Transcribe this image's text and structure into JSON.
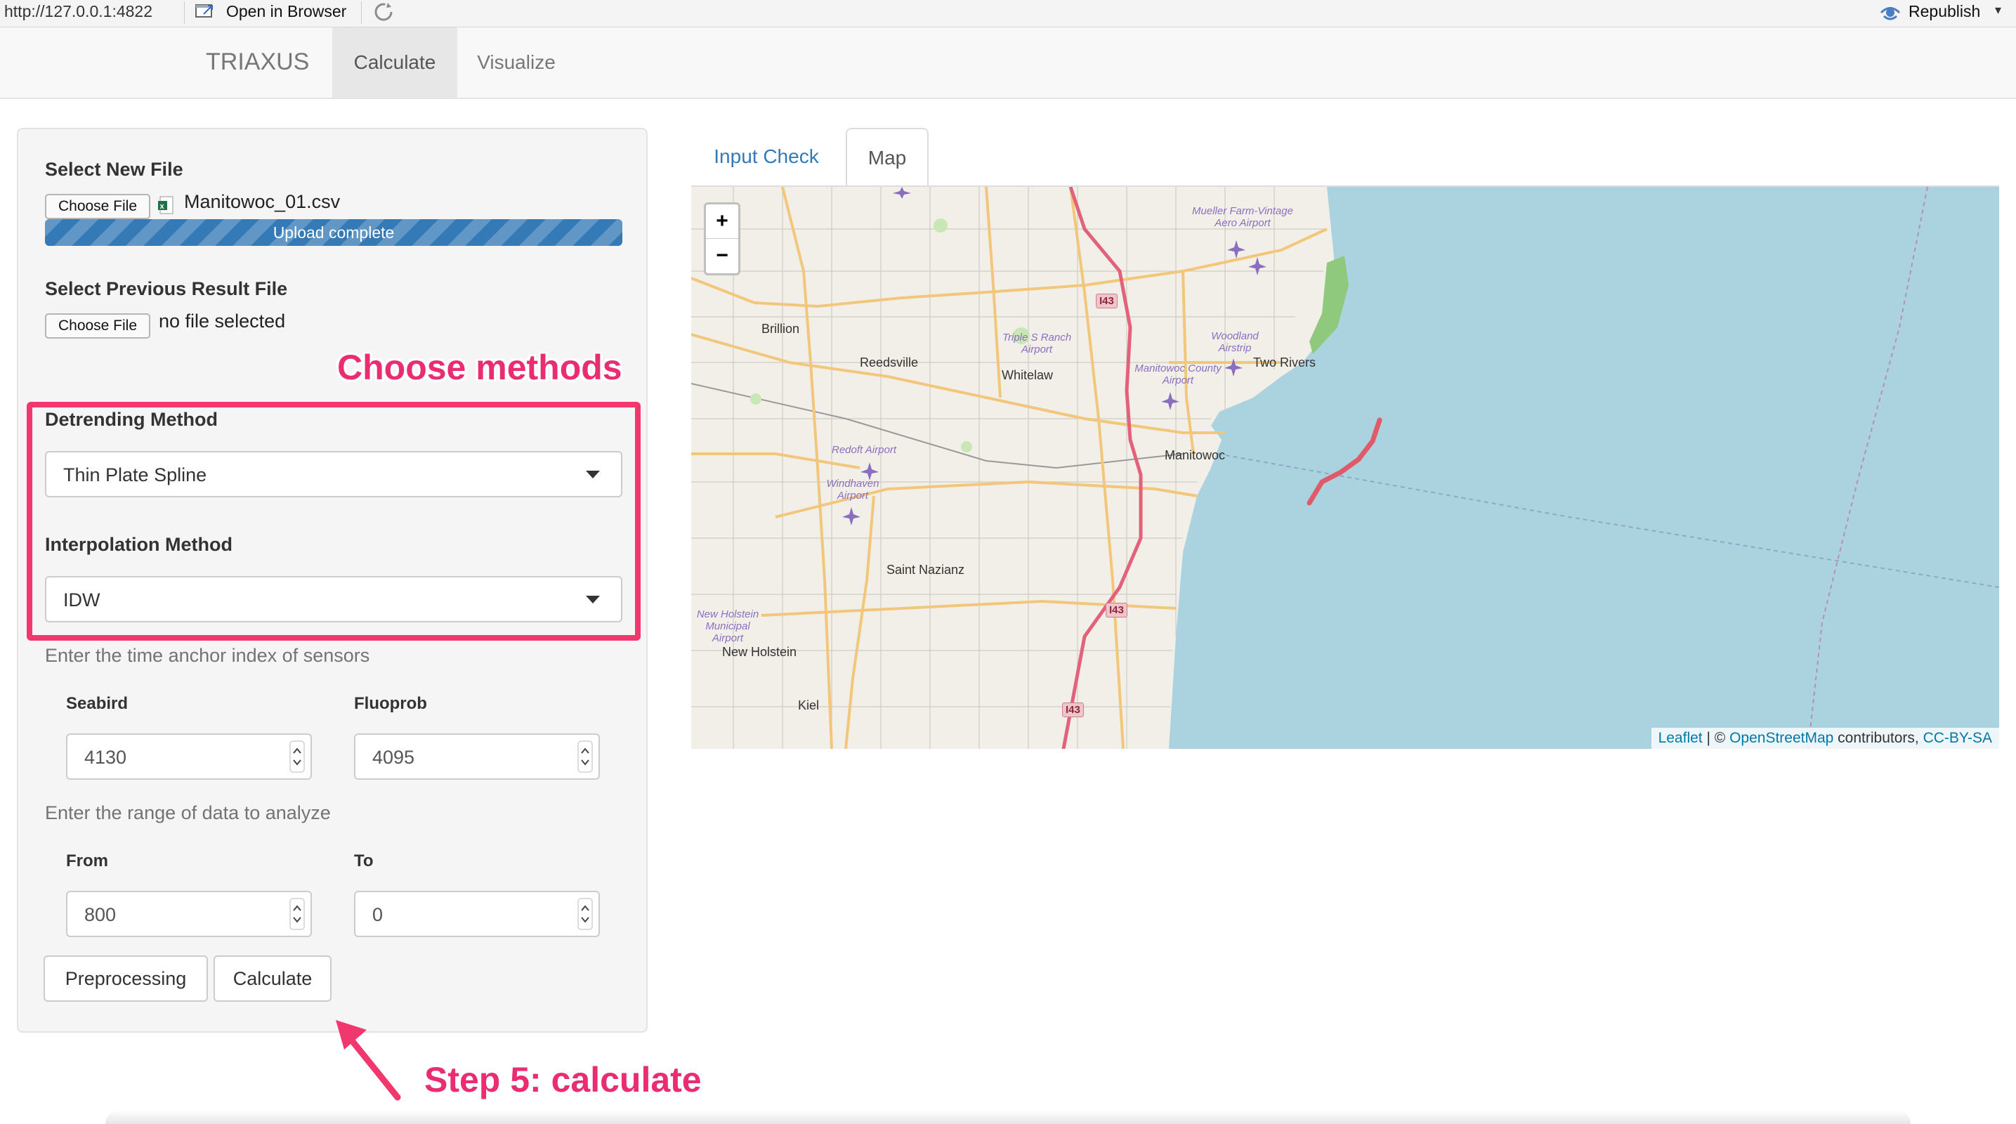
{
  "viewer": {
    "url": "http://127.0.0.1:4822",
    "open_in_browser": "Open in Browser",
    "republish": "Republish"
  },
  "navbar": {
    "brand": "TRIAXUS",
    "tabs": [
      "Calculate",
      "Visualize"
    ],
    "active_tab": "Calculate"
  },
  "sidebar": {
    "new_file_label": "Select New File",
    "choose_file": "Choose File",
    "new_file_name": "Manitowoc_01.csv",
    "upload_status": "Upload complete",
    "upload_progress": 1.0,
    "prev_file_label": "Select Previous Result File",
    "prev_file_name": "no file selected",
    "detrending_label": "Detrending Method",
    "detrending_value": "Thin Plate Spline",
    "interpolation_label": "Interpolation Method",
    "interpolation_value": "IDW",
    "time_anchor_help": "Enter the time anchor index of sensors",
    "seabird_label": "Seabird",
    "seabird_value": "4130",
    "fluoprob_label": "Fluoprob",
    "fluoprob_value": "4095",
    "range_help": "Enter the range of data to analyze",
    "from_label": "From",
    "from_value": "800",
    "to_label": "To",
    "to_value": "0",
    "preprocessing_button": "Preprocessing",
    "calculate_button": "Calculate"
  },
  "main": {
    "tabs": [
      "Input Check",
      "Map"
    ],
    "active_tab": "Map"
  },
  "map": {
    "zoom_in": "+",
    "zoom_out": "−",
    "places": [
      "Brillion",
      "Reedsville",
      "Whitelaw",
      "Two Rivers",
      "Manitowoc",
      "Saint Nazianz",
      "New Holstein",
      "Kiel"
    ],
    "airports": [
      "Mueller Farm-Vintage Aero Airport",
      "Triple S Ranch Airport",
      "Woodland Airstrip",
      "Manitowoc County Airport",
      "Redoft Airport",
      "Windhaven Airport",
      "New Holstein Municipal Airport"
    ],
    "highway": "I43",
    "attribution": {
      "leaflet": "Leaflet",
      "sep": " | © ",
      "osm": "OpenStreetMap",
      "contributors": " contributors, ",
      "license": "CC-BY-SA"
    },
    "colors": {
      "water": "#aad3df",
      "land": "#f2efe9",
      "track": "#e05a6a",
      "highway": "#e3627b"
    }
  },
  "annotations": {
    "choose_methods": "Choose methods",
    "step5": "Step 5: calculate",
    "color": "#ea2c73"
  }
}
